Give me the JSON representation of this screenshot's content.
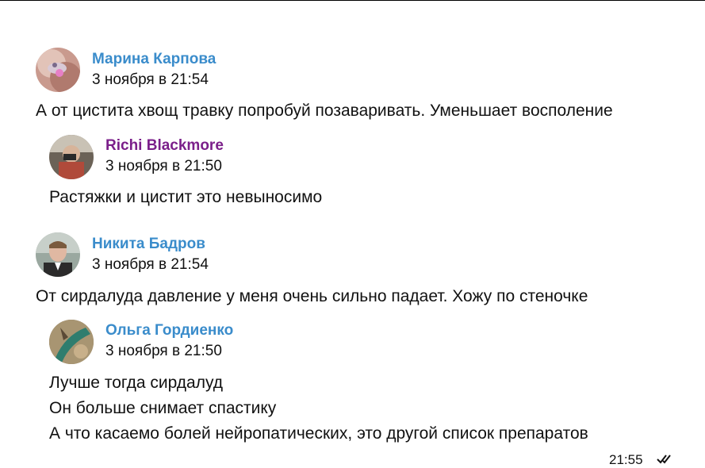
{
  "posts": [
    {
      "author": "Марина Карпова",
      "author_color": "#3a8ccb",
      "date": "3 ноября в 21:54",
      "text": "А от цистита хвощ травку попробуй позаваривать. Уменьшает восполение",
      "quote": {
        "author": "Richi Blackmore",
        "author_color": "#7b1f8a",
        "date": "3 ноября в 21:50",
        "lines": [
          "Растяжки и цистит это невыносимо"
        ]
      }
    },
    {
      "author": "Никита Бадров",
      "author_color": "#3a8ccb",
      "date": "3 ноября в 21:54",
      "text": "От сирдалуда давление у меня очень сильно падает. Хожу по стеночке",
      "quote": {
        "author": "Ольга Гордиенко",
        "author_color": "#3a8ccb",
        "date": "3 ноября в 21:50",
        "lines": [
          "Лучше тогда сирдалуд",
          "Он больше снимает спастику",
          "А что касаемо болей нейропатических, это другой список препаратов"
        ]
      }
    }
  ],
  "footer": {
    "time": "21:55"
  }
}
